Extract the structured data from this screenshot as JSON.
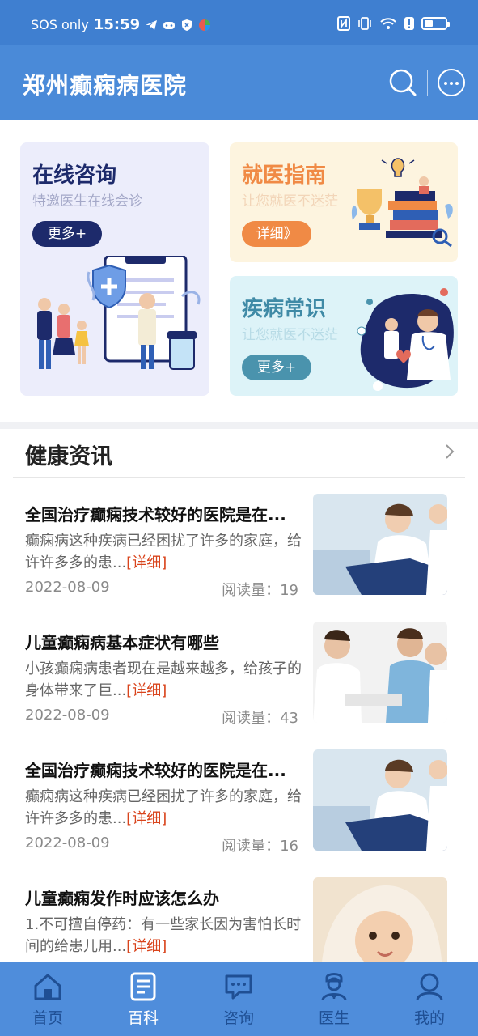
{
  "status_bar": {
    "carrier": "SOS only",
    "time": "15:59"
  },
  "header": {
    "title": "郑州癫痫病医院",
    "search_icon": "search-icon",
    "more_icon": "more-dots-icon"
  },
  "cards": {
    "online": {
      "title": "在线咨询",
      "subtitle": "特邀医生在线会诊",
      "button": "更多+"
    },
    "guide": {
      "title": "就医指南",
      "subtitle": "让您就医不迷茫",
      "button": "详细》"
    },
    "knowledge": {
      "title": "疾病常识",
      "subtitle": "让您就医不迷茫",
      "button": "更多+"
    }
  },
  "news": {
    "section_title": "健康资讯",
    "detail_link": "[详细]",
    "items": [
      {
        "title": "全国治疗癫痫技术较好的医院是在...",
        "summary": "癫痫病这种疾病已经困扰了许多的家庭，给许许多多的患...",
        "date": "2022-08-09",
        "reads": "阅读量：19"
      },
      {
        "title": "儿童癫痫病基本症状有哪些",
        "summary": "小孩癫痫病患者现在是越来越多，给孩子的身体带来了巨...",
        "date": "2022-08-09",
        "reads": "阅读量：43"
      },
      {
        "title": "全国治疗癫痫技术较好的医院是在...",
        "summary": "癫痫病这种疾病已经困扰了许多的家庭，给许许多多的患...",
        "date": "2022-08-09",
        "reads": "阅读量：16"
      },
      {
        "title": "儿童癫痫发作时应该怎么办",
        "summary": "1.不可擅自停药：有一些家长因为害怕长时间的给患儿用...",
        "date": "",
        "reads": ""
      }
    ]
  },
  "bottom_nav": {
    "items": [
      {
        "label": "首页",
        "icon": "home-icon"
      },
      {
        "label": "百科",
        "icon": "encyclopedia-icon"
      },
      {
        "label": "咨询",
        "icon": "chat-icon"
      },
      {
        "label": "医生",
        "icon": "doctor-icon"
      },
      {
        "label": "我的",
        "icon": "user-icon"
      }
    ],
    "active_index": 1
  },
  "colors": {
    "primary": "#4a8ad8",
    "status_bar": "#3f7fd0",
    "online_accent": "#1d2a6b",
    "guide_accent": "#f08a45",
    "knowledge_accent": "#4a93ad",
    "detail_link": "#d9441c"
  }
}
